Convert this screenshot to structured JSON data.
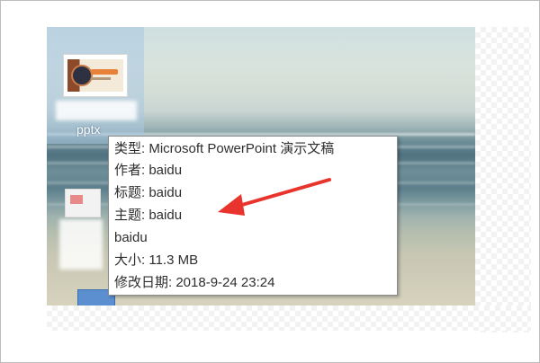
{
  "desktop": {
    "selected_icon_label": "pptx"
  },
  "tooltip": {
    "rows": [
      "类型: Microsoft PowerPoint 演示文稿",
      "作者: baidu",
      "标题: baidu",
      "主题: baidu",
      "baidu",
      "大小: 11.3 MB",
      "修改日期: 2018-9-24 23:24"
    ]
  },
  "colors": {
    "arrow": "#e8342c",
    "selection": "#aac8e1",
    "tooltip_border": "#8c8c8c"
  },
  "icons": [
    "pptx-file-icon",
    "file-icon",
    "file-icon"
  ]
}
